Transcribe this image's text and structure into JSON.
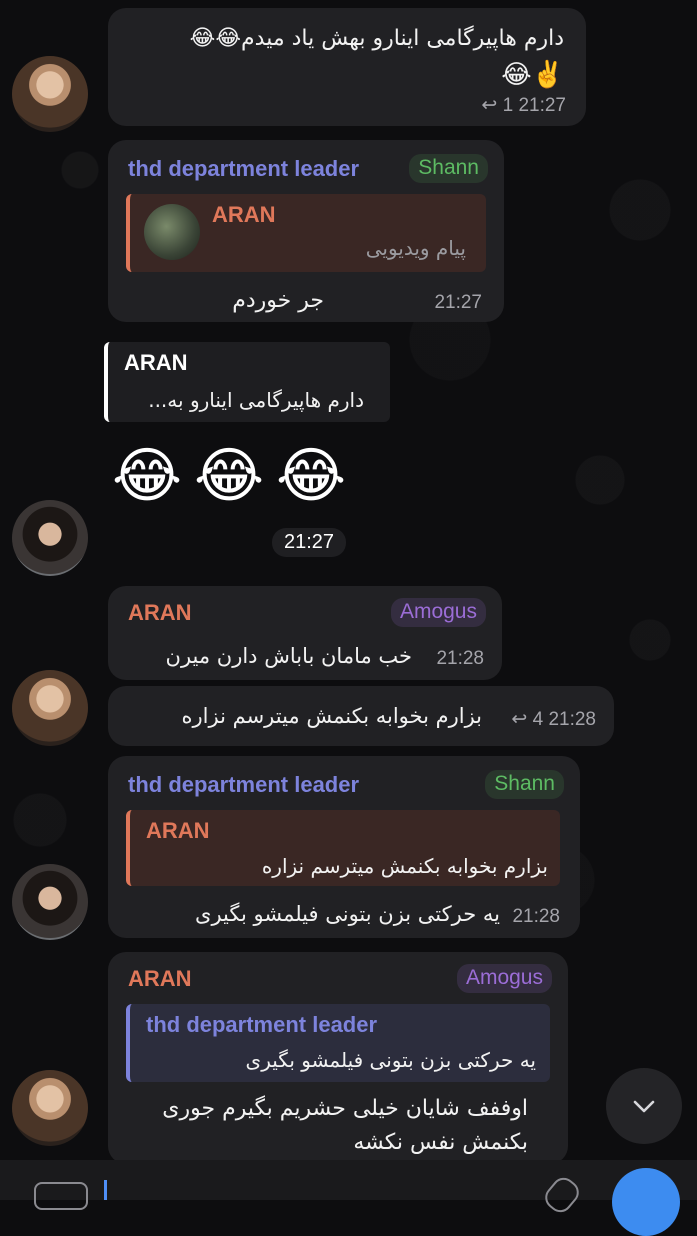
{
  "messages": {
    "m1": {
      "text": "دارم هاپیرگامی اینارو بهش یاد میدم😂😂",
      "line2": "✌️😂",
      "reply_count": "1",
      "time": "21:27"
    },
    "m2": {
      "sender": "thd department leader",
      "tag": "Shann",
      "quote_sender": "ARAN",
      "quote_text": "پیام ویدیویی",
      "text": "جر خوردم",
      "time": "21:27"
    },
    "m3": {
      "quote_sender": "ARAN",
      "quote_text": "دارم هاپیرگامی اینارو به...",
      "emojis": [
        "😂",
        "😂",
        "😂"
      ],
      "time": "21:27"
    },
    "m4": {
      "sender": "ARAN",
      "tag": "Amogus",
      "text": "خب مامان باباش دارن میرن",
      "time": "21:28"
    },
    "m5": {
      "text": "بزارم بخوابه بکنمش میترسم نزاره",
      "reply_count": "4",
      "time": "21:28"
    },
    "m6": {
      "sender": "thd department leader",
      "tag": "Shann",
      "quote_sender": "ARAN",
      "quote_text": "بزارم بخوابه بکنمش میترسم نزاره",
      "text": "یه حرکتی بزن بتونی فیلمشو بگیری",
      "time": "21:28"
    },
    "m7": {
      "sender": "ARAN",
      "tag": "Amogus",
      "quote_sender": "thd department leader",
      "quote_text": "یه حرکتی بزن بتونی فیلمشو بگیری",
      "line1": "اوففف شایان خیلی حشریم بگیرم جوری",
      "line2": "بکنمش نفس نکشه"
    }
  },
  "icons": {
    "reply": "reply-arrow-icon",
    "scroll": "chevron-down-icon",
    "attach": "paperclip-icon",
    "gif": "gif-icon",
    "mic": "mic-icon"
  },
  "colors": {
    "bubble": "#212124",
    "blue_name": "#7d83dc",
    "orange_name": "#e0785a",
    "green_tag": "#5dbb63",
    "purple_tag": "#9b6dd6"
  }
}
